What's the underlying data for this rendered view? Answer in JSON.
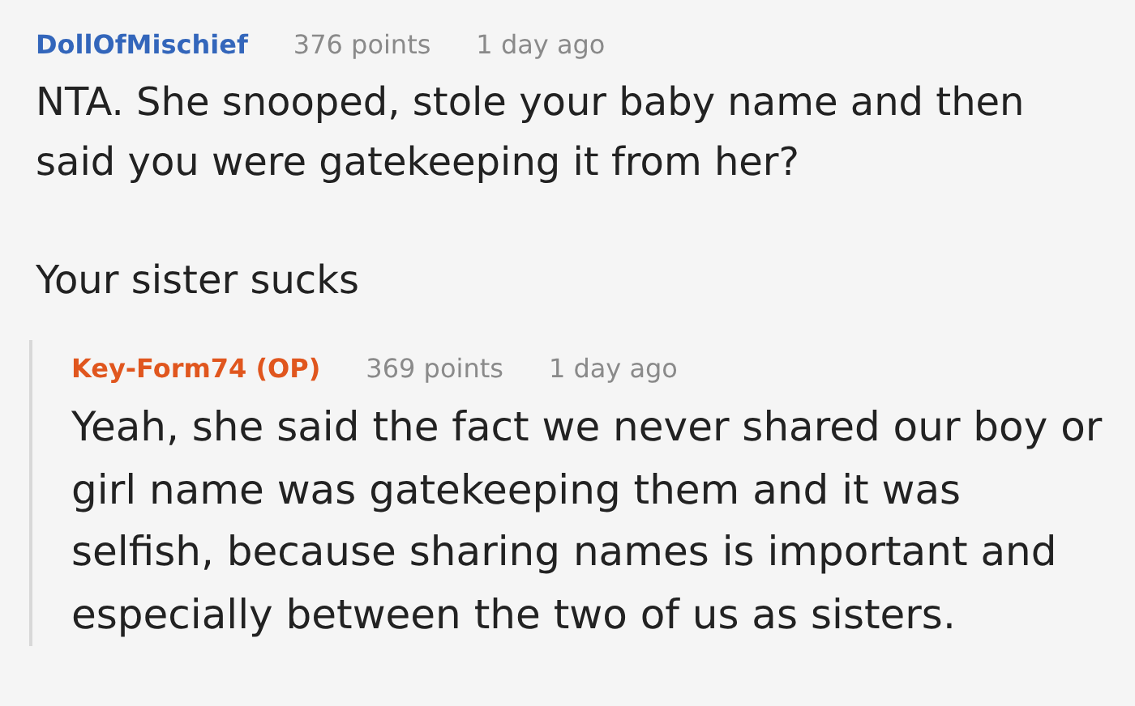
{
  "comments": [
    {
      "author": "DollOfMischief",
      "kind": "user",
      "points": "376 points",
      "time": "1 day ago",
      "paragraphs": [
        "NTA. She snooped, stole your baby name and then said you were gatekeeping it from her?",
        "Your sister sucks"
      ],
      "replies": [
        {
          "author": "Key-Form74 (OP)",
          "kind": "op",
          "points": "369 points",
          "time": "1 day ago",
          "paragraphs": [
            "Yeah, she said the fact we never shared our boy or girl name was gatekeeping them and it was selfish, because sharing names is important and especially between the two of us as sisters."
          ]
        }
      ]
    }
  ]
}
